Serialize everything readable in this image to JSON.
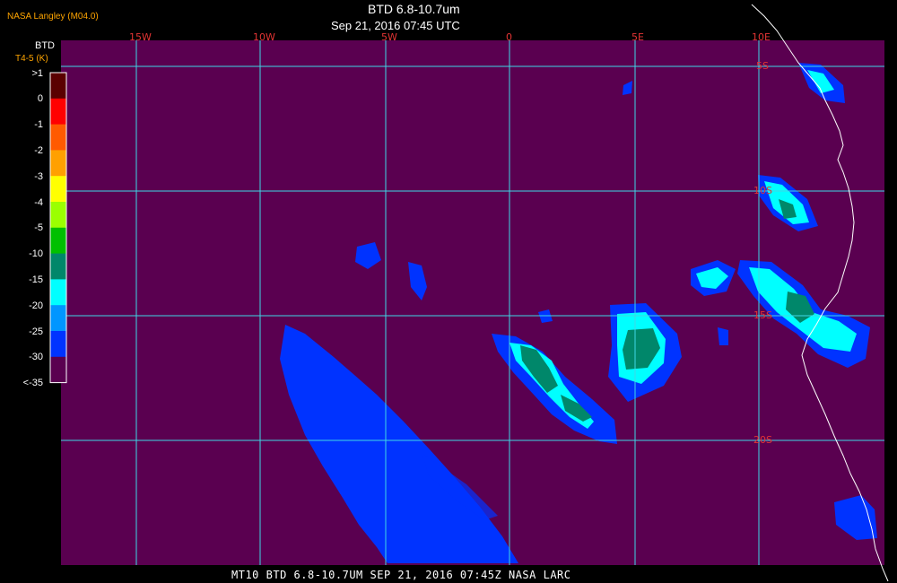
{
  "header": {
    "agency": "NASA Langley (M04.0)",
    "title": "BTD 6.8-10.7um",
    "subtitle": "Sep 21, 2016 07:45 UTC"
  },
  "legend": {
    "title": "BTD",
    "unit": "T4-5 (K)",
    "ticks": [
      ">1",
      "0",
      "-1",
      "-2",
      "-3",
      "-4",
      "-5",
      "-10",
      "-15",
      "-20",
      "-25",
      "-30",
      "<-35"
    ],
    "colors": [
      "#5a0000",
      "#ff0000",
      "#ff5a00",
      "#ffa000",
      "#ffff00",
      "#9bff00",
      "#00c000",
      "#00876a",
      "#00ffff",
      "#0096ff",
      "#0033ff",
      "#5a0050"
    ]
  },
  "map": {
    "background_color": "#5a0050",
    "grid_color": "#3fd7e6",
    "coast_color": "#ffffff",
    "lon_labels": [
      "15W",
      "10W",
      "5W",
      "0",
      "5E",
      "10E"
    ],
    "lat_labels": [
      "5S",
      "10S",
      "15S",
      "20S"
    ]
  },
  "footer": {
    "text": "MT10  BTD 6.8-10.7UM  SEP 21, 2016 07:45Z  NASA LARC"
  }
}
